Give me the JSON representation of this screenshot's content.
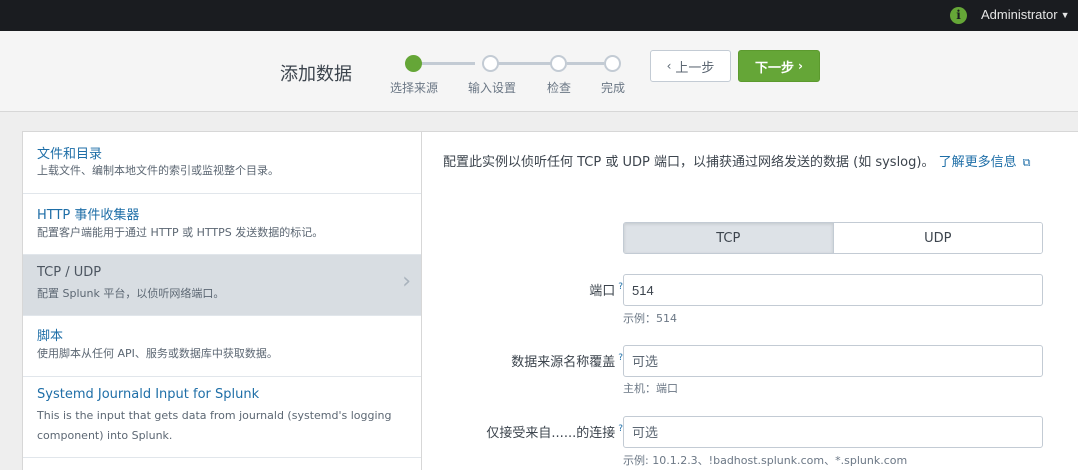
{
  "topbar": {
    "info_icon": "info-circle-icon",
    "user": "Administrator"
  },
  "header": {
    "title": "添加数据",
    "steps": [
      {
        "label": "选择来源",
        "active": true
      },
      {
        "label": "输入设置",
        "active": false
      },
      {
        "label": "检查",
        "active": false
      },
      {
        "label": "完成",
        "active": false
      }
    ],
    "prev_label": "上一步",
    "next_label": "下一步"
  },
  "sources": [
    {
      "title": "文件和目录",
      "desc": "上载文件、编制本地文件的索引或监视整个目录。"
    },
    {
      "title": "HTTP 事件收集器",
      "desc": "配置客户端能用于通过 HTTP 或 HTTPS 发送数据的标记。"
    },
    {
      "title": "TCP / UDP",
      "desc": "配置 Splunk 平台，以侦听网络端口。",
      "selected": true
    },
    {
      "title": "脚本",
      "desc": "使用脚本从任何 API、服务或数据库中获取数据。"
    },
    {
      "title": "Systemd Journald Input for Splunk",
      "desc": "This is the input that gets data from journald (systemd's logging component) into Splunk."
    }
  ],
  "config": {
    "intro": "配置此实例以侦听任何 TCP 或 UDP 端口，以捕获通过网络发送的数据 (如 syslog)。",
    "learn_more": "了解更多信息",
    "protocols": [
      "TCP",
      "UDP"
    ],
    "selected_protocol": "TCP",
    "fields": [
      {
        "label": "端口",
        "value": "514",
        "placeholder": "",
        "help": "示例：514"
      },
      {
        "label": "数据来源名称覆盖",
        "value": "",
        "placeholder": "可选",
        "help": "主机：端口"
      },
      {
        "label": "仅接受来自......的连接",
        "value": "",
        "placeholder": "可选",
        "help": "示例: 10.1.2.3、!badhost.splunk.com、*.splunk.com"
      }
    ],
    "help_mark": "?"
  }
}
